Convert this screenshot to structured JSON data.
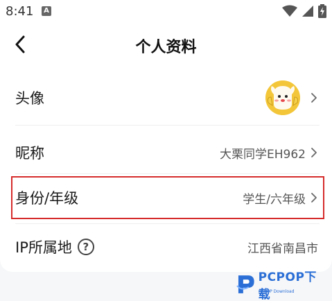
{
  "status_bar": {
    "time": "8:41",
    "notification_letter": "A",
    "icons": [
      "wifi-icon",
      "signal-icon",
      "battery-charging-icon"
    ]
  },
  "header": {
    "title": "个人资料",
    "back_icon": "chevron-left-icon"
  },
  "rows": {
    "avatar": {
      "label": "头像"
    },
    "nickname": {
      "label": "昵称",
      "value": "大栗同学EH962"
    },
    "identity": {
      "label": "身份/年级",
      "value": "学生/六年级"
    },
    "ip": {
      "label": "IP所属地",
      "value": "江西省南昌市",
      "help_icon": "?"
    }
  },
  "highlight_color": "#d62b2b",
  "watermark": {
    "logo": "P",
    "text": "PCPOP下载",
    "subtext": "PCPOP Download"
  }
}
